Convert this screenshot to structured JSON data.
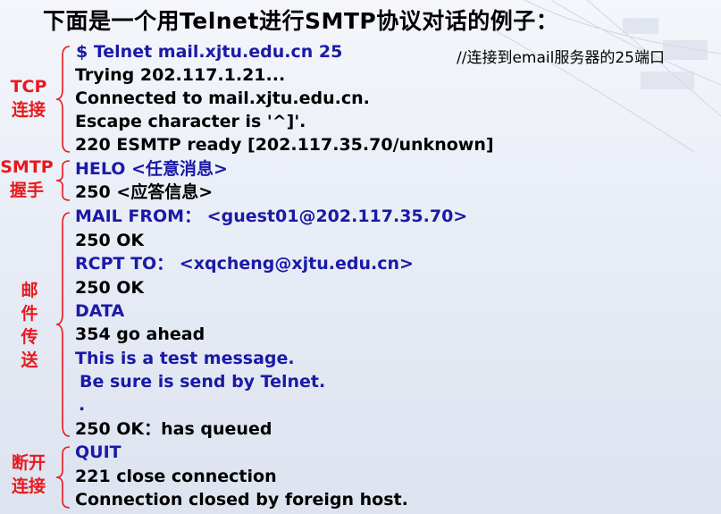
{
  "title": "下面是一个用Telnet进行SMTP协议对话的例子：",
  "comment": "//连接到email服务器的25端口",
  "lines": [
    {
      "text": "$ Telnet mail.xjtu.edu.cn 25",
      "color": "#1a1aa6"
    },
    {
      "text": "Trying 202.117.1.21...",
      "color": "#000000"
    },
    {
      "text": "Connected to mail.xjtu.edu.cn.",
      "color": "#000000"
    },
    {
      "text": "Escape character is '^]'.",
      "color": "#000000"
    },
    {
      "text": "220 ESMTP ready [202.117.35.70/unknown]",
      "color": "#000000"
    },
    {
      "text": "HELO <任意消息>",
      "color": "#1a1aa6"
    },
    {
      "text": "250 <应答信息>",
      "color": "#000000"
    },
    {
      "text": "MAIL FROM： <guest01@202.117.35.70>",
      "color": "#1a1aa6"
    },
    {
      "text": "250 OK",
      "color": "#000000"
    },
    {
      "text": "RCPT TO： <xqcheng@xjtu.edu.cn>",
      "color": "#1a1aa6"
    },
    {
      "text": "250 OK",
      "color": "#000000"
    },
    {
      "text": "DATA",
      "color": "#1a1aa6"
    },
    {
      "text": "354 go ahead",
      "color": "#000000"
    },
    {
      "text": "This is a test message.",
      "color": "#1a1aa6"
    },
    {
      "text": "Be sure is send by Telnet.",
      "color": "#1a1aa6"
    },
    {
      "text": ".",
      "color": "#1a1aa6"
    },
    {
      "text": "250 OK：has queued",
      "color": "#000000"
    },
    {
      "text": "QUIT",
      "color": "#1a1aa6"
    },
    {
      "text": "221 close connection",
      "color": "#000000"
    },
    {
      "text": "Connection closed by foreign host.",
      "color": "#000000"
    }
  ],
  "labels": {
    "tcp": [
      "TCP",
      "连接"
    ],
    "smtp": [
      "SMTP",
      "握手"
    ],
    "mail": [
      "邮",
      "件",
      "传",
      "送"
    ],
    "close": [
      "断开",
      "连接"
    ]
  },
  "colors": {
    "label": "#e8191e",
    "command": "#1a1aa6",
    "response": "#000000"
  }
}
